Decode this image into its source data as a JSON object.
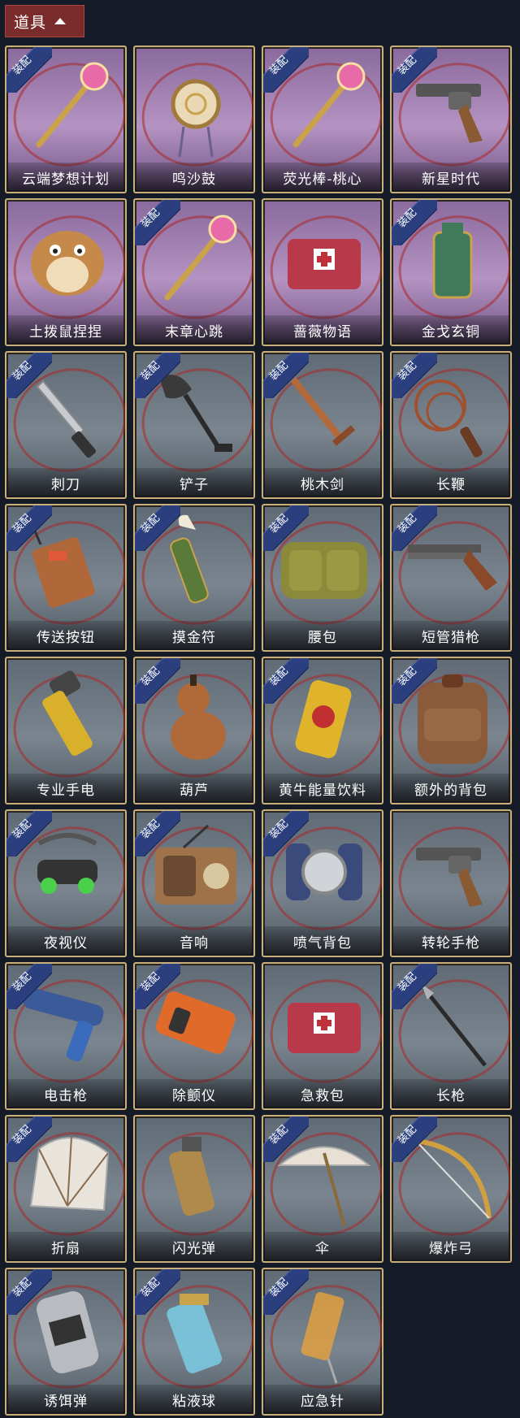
{
  "header": {
    "title": "道具",
    "icon": "chevron-up-icon"
  },
  "badge_label": "装配",
  "items": [
    {
      "name": "云端梦想计划",
      "equipped": true,
      "theme": "purple",
      "icon": "wand-icon"
    },
    {
      "name": "鸣沙鼓",
      "equipped": false,
      "theme": "purple",
      "icon": "drum-icon"
    },
    {
      "name": "荧光棒-桃心",
      "equipped": true,
      "theme": "purple",
      "icon": "wand-icon"
    },
    {
      "name": "新星时代",
      "equipped": true,
      "theme": "purple",
      "icon": "revolver-icon"
    },
    {
      "name": "土拨鼠捏捏",
      "equipped": false,
      "theme": "purple",
      "icon": "hamster-icon"
    },
    {
      "name": "末章心跳",
      "equipped": true,
      "theme": "purple",
      "icon": "wand-icon"
    },
    {
      "name": "蔷薇物语",
      "equipped": false,
      "theme": "purple",
      "icon": "medkit-icon"
    },
    {
      "name": "金戈玄铜",
      "equipped": true,
      "theme": "purple",
      "icon": "grenade-icon"
    },
    {
      "name": "刺刀",
      "equipped": true,
      "theme": "gray",
      "icon": "knife-icon"
    },
    {
      "name": "铲子",
      "equipped": true,
      "theme": "gray",
      "icon": "shovel-icon"
    },
    {
      "name": "桃木剑",
      "equipped": true,
      "theme": "gray",
      "icon": "sword-icon"
    },
    {
      "name": "长鞭",
      "equipped": true,
      "theme": "gray",
      "icon": "whip-icon"
    },
    {
      "name": "传送按钮",
      "equipped": true,
      "theme": "gray",
      "icon": "remote-icon"
    },
    {
      "name": "摸金符",
      "equipped": true,
      "theme": "gray",
      "icon": "talisman-icon"
    },
    {
      "name": "腰包",
      "equipped": true,
      "theme": "gray",
      "icon": "bag-icon"
    },
    {
      "name": "短管猎枪",
      "equipped": true,
      "theme": "gray",
      "icon": "shotgun-icon"
    },
    {
      "name": "专业手电",
      "equipped": false,
      "theme": "gray",
      "icon": "flashlight-icon"
    },
    {
      "name": "葫芦",
      "equipped": true,
      "theme": "gray",
      "icon": "gourd-icon"
    },
    {
      "name": "黄牛能量饮料",
      "equipped": true,
      "theme": "gray",
      "icon": "can-icon"
    },
    {
      "name": "额外的背包",
      "equipped": true,
      "theme": "gray",
      "icon": "backpack-icon"
    },
    {
      "name": "夜视仪",
      "equipped": true,
      "theme": "gray",
      "icon": "goggles-icon"
    },
    {
      "name": "音响",
      "equipped": true,
      "theme": "gray",
      "icon": "radio-icon"
    },
    {
      "name": "喷气背包",
      "equipped": true,
      "theme": "gray",
      "icon": "jetpack-icon"
    },
    {
      "name": "转轮手枪",
      "equipped": false,
      "theme": "gray",
      "icon": "revolver-icon"
    },
    {
      "name": "电击枪",
      "equipped": true,
      "theme": "gray",
      "icon": "stun-gun-icon"
    },
    {
      "name": "除颤仪",
      "equipped": true,
      "theme": "gray",
      "icon": "defibrillator-icon"
    },
    {
      "name": "急救包",
      "equipped": false,
      "theme": "gray",
      "icon": "medkit-icon"
    },
    {
      "name": "长枪",
      "equipped": true,
      "theme": "gray",
      "icon": "spear-icon"
    },
    {
      "name": "折扇",
      "equipped": true,
      "theme": "gray",
      "icon": "fan-icon"
    },
    {
      "name": "闪光弹",
      "equipped": false,
      "theme": "gray",
      "icon": "flashbang-icon"
    },
    {
      "name": "伞",
      "equipped": true,
      "theme": "gray",
      "icon": "umbrella-icon"
    },
    {
      "name": "爆炸弓",
      "equipped": true,
      "theme": "gray",
      "icon": "bow-icon"
    },
    {
      "name": "诱饵弹",
      "equipped": true,
      "theme": "gray",
      "icon": "canister-icon"
    },
    {
      "name": "粘液球",
      "equipped": true,
      "theme": "gray",
      "icon": "vial-icon"
    },
    {
      "name": "应急针",
      "equipped": true,
      "theme": "gray",
      "icon": "syringe-icon"
    }
  ]
}
